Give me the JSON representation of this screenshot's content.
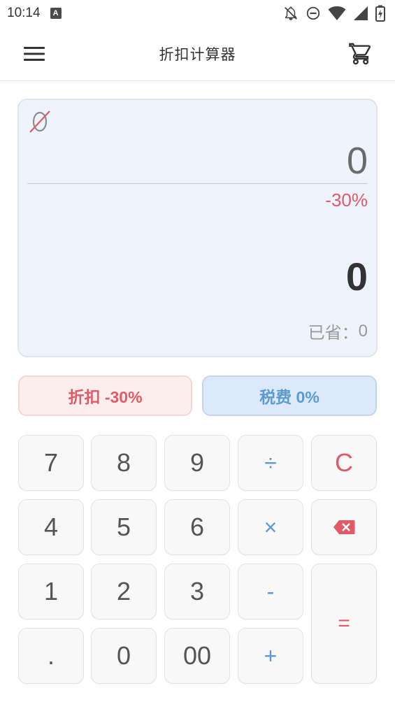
{
  "status_bar": {
    "time": "10:14",
    "a_badge": "A",
    "icons": [
      "notifications-off-icon",
      "do-not-disturb-icon",
      "wifi-icon",
      "signal-icon",
      "battery-charging-icon"
    ]
  },
  "app_bar": {
    "title": "折扣计算器",
    "menu_icon": "menu-icon",
    "cart_icon": "shopping-cart-icon"
  },
  "display": {
    "empty_symbol": "Ø",
    "input_value": "0",
    "discount_tag": "-30%",
    "result_value": "0",
    "saved_label": "已省：",
    "saved_value": "0"
  },
  "modes": {
    "discount_label": "折扣 -30%",
    "tax_label": "税费 0%"
  },
  "keypad": {
    "k7": "7",
    "k8": "8",
    "k9": "9",
    "divide": "÷",
    "clear": "C",
    "k4": "4",
    "k5": "5",
    "k6": "6",
    "multiply": "×",
    "backspace_icon": "backspace-icon",
    "k1": "1",
    "k2": "2",
    "k3": "3",
    "minus": "-",
    "equals": "=",
    "dot": ".",
    "k0": "0",
    "k00": "00",
    "plus": "+"
  },
  "colors": {
    "accent_red": "#e05a67",
    "accent_blue": "#5b9bd0",
    "display_bg": "#eef3fc"
  }
}
